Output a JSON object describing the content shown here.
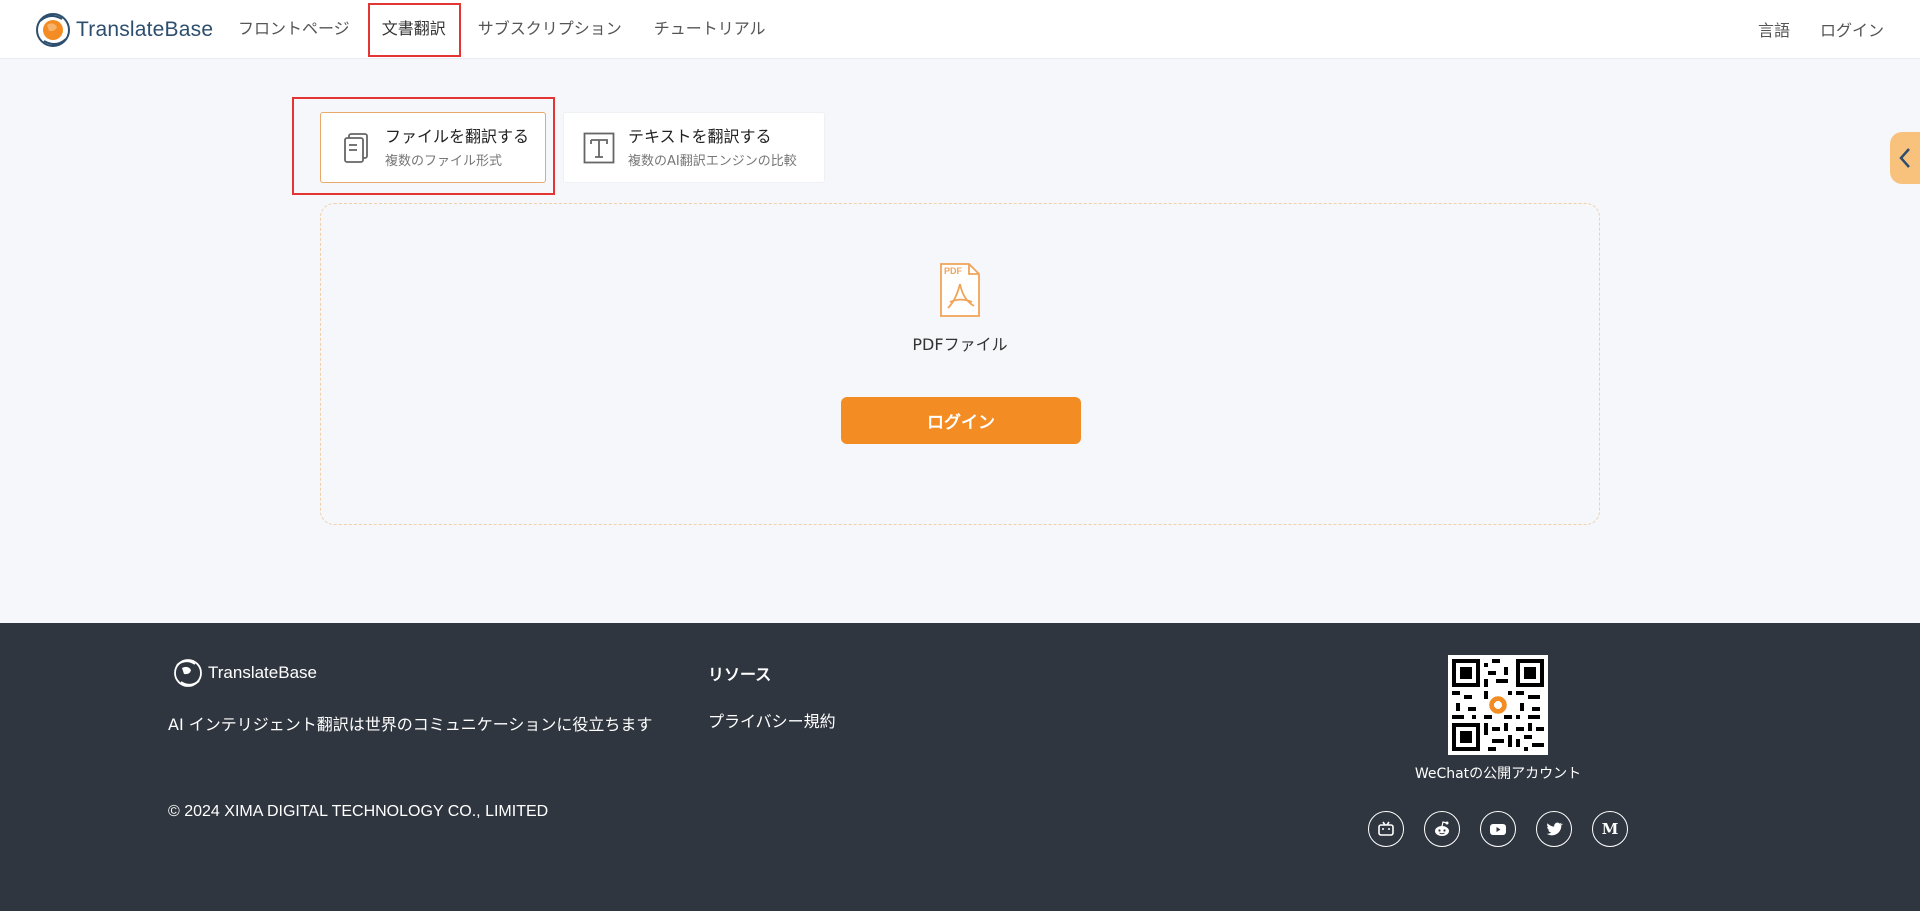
{
  "brand": {
    "name": "TranslateBase",
    "accent": "#f28c23",
    "header_text_color": "#2d4e6e"
  },
  "nav": {
    "items": [
      {
        "label": "フロントページ"
      },
      {
        "label": "文書翻訳"
      },
      {
        "label": "サブスクリプション"
      },
      {
        "label": "チュートリアル"
      }
    ],
    "active_index": 1
  },
  "header_right": {
    "language": "言語",
    "login": "ログイン"
  },
  "mode_tabs": [
    {
      "title": "ファイルを翻訳する",
      "subtitle": "複数のファイル形式",
      "icon": "document-icon",
      "selected": true
    },
    {
      "title": "テキストを翻訳する",
      "subtitle": "複数のAI翻訳エンジンの比較",
      "icon": "text-t-icon",
      "selected": false
    }
  ],
  "upload": {
    "file_type_label": "PDFファイル",
    "pdf_badge": "PDF",
    "login_button": "ログイン"
  },
  "side_tab": {
    "icon": "chevron-left-icon"
  },
  "footer": {
    "brand": "TranslateBase",
    "slogan": "AI インテリジェント翻訳は世界のコミュニケーションに役立ちます",
    "copyright": "© 2024 XIMA DIGITAL TECHNOLOGY CO., LIMITED",
    "resources_title": "リソース",
    "privacy_link": "プライバシー規約",
    "wechat_label": "WeChatの公開アカウント",
    "socials": [
      "bilibili-icon",
      "reddit-icon",
      "youtube-icon",
      "twitter-icon",
      "medium-icon"
    ],
    "bg_color": "#30363f"
  }
}
